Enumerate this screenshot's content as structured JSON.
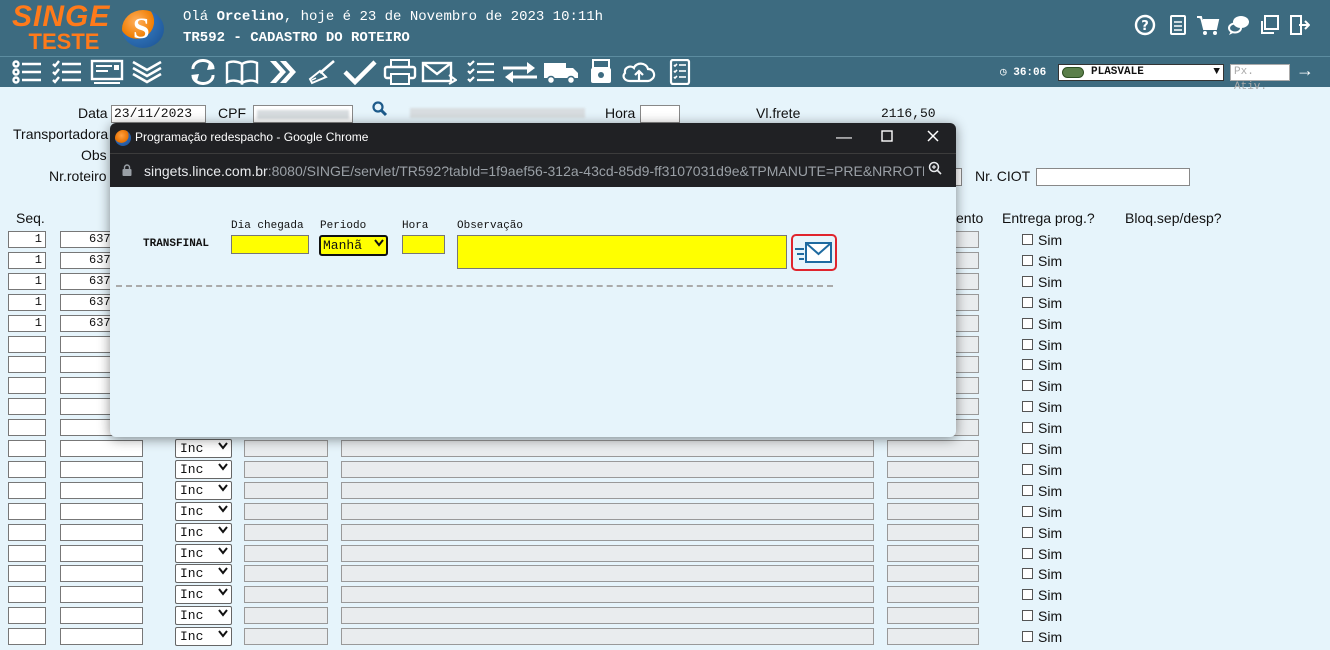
{
  "header": {
    "logo_line1": "SINGE",
    "logo_line2": "TESTE",
    "greeting_prefix": "Olá ",
    "user": "Orcelino",
    "greeting_suffix": ", hoje é 23 de Novembro de 2023 10:11h",
    "screen_title": "TR592 - CADASTRO DO ROTEIRO",
    "icons": [
      "help-icon",
      "document-icon",
      "cart-icon",
      "chat-icon",
      "windows-icon",
      "exit-icon"
    ]
  },
  "toolbar": {
    "icons": [
      "list-icon",
      "checklist-icon",
      "screen-list-icon",
      "layers-icon",
      "refresh-icon",
      "book-icon",
      "fast-forward-icon",
      "broom-icon",
      "check-icon",
      "print-icon",
      "mail-icon",
      "tasks-icon",
      "transfer-icon",
      "truck-icon",
      "printer-box-icon",
      "cloud-upload-icon",
      "notes-icon"
    ],
    "clock": "36:06",
    "company": "PLASVALE",
    "px_ativ_placeholder": "Px. Ativ."
  },
  "form": {
    "data_label": "Data",
    "data_value": "23/11/2023",
    "cpf_label": "CPF",
    "hora_label": "Hora",
    "vlfrete_label": "Vl.frete",
    "vlfrete_value": "2116,50",
    "transportadora_label": "Transportadora",
    "obs_label": "Obs",
    "nrroteiro_label": "Nr.roteiro",
    "nrciot_label": "Nr. CIOT",
    "col_seq": "Seq.",
    "col_pagamento": "ento",
    "col_entrega": "Entrega prog.?",
    "col_bloq": "Bloq.sep/desp?",
    "rows_filled": [
      {
        "seq": "1",
        "num": "637"
      },
      {
        "seq": "1",
        "num": "637"
      },
      {
        "seq": "1",
        "num": "637"
      },
      {
        "seq": "1",
        "num": "637"
      },
      {
        "seq": "1",
        "num": "637"
      }
    ],
    "select_value": "Inc",
    "sim_label": "Sim"
  },
  "popup": {
    "window_title": "Programação redespacho - Google Chrome",
    "url_host": "singets.lince.com.br",
    "url_rest": ":8080/SINGE/servlet/TR592?tabId=1f9aef56-312a-43cd-85d9-ff3107031d9e&TPMANUTE=PRE&NRROTE...",
    "route_name": "TRANSFINAL",
    "dia_chegada_label": "Dia chegada",
    "periodo_label": "Periodo",
    "periodo_value": "Manhã",
    "hora_label": "Hora",
    "observacao_label": "Observação"
  }
}
